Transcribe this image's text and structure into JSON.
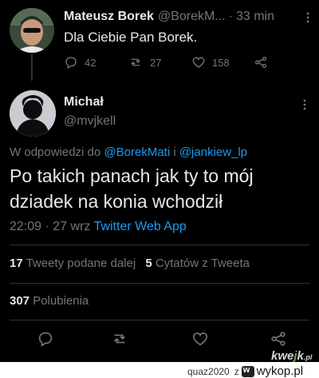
{
  "parent_tweet": {
    "author_name": "Mateusz Borek",
    "author_handle": "@BorekM...",
    "separator": "·",
    "time": "33 min",
    "text": "Dla Ciebie Pan Borek.",
    "replies": "42",
    "retweets": "27",
    "likes": "158"
  },
  "main_tweet": {
    "author_name": "Michał",
    "author_handle": "@mvjkell",
    "reply_prefix": "W odpowiedzi do ",
    "reply_user_1": "@BorekMati",
    "reply_conj": " i ",
    "reply_user_2": "@jankiew_lp",
    "text_line1": "Po takich panach jak ty to mój",
    "text_line2": "dziadek na konia wchodził",
    "time": "22:09",
    "date": " · 27 wrz ",
    "source": "Twitter Web App"
  },
  "stats": {
    "retweets_count": "17",
    "retweets_label": " Tweety podane dalej",
    "quotes_count": "5",
    "quotes_label": " Cytatów z Tweeta",
    "likes_count": "307",
    "likes_label": " Polubienia"
  },
  "watermark": {
    "kw": "kw",
    "e": "e",
    "j": "j",
    "k": "k",
    "pl": ".pl"
  },
  "footer": {
    "user": "quaz2020",
    "z": "z",
    "logo_letter": "w",
    "site": "wykop.pl"
  },
  "colors": {
    "background": "#000000",
    "text": "#e7e9ea",
    "secondary": "#71767b",
    "link": "#1d9bf0",
    "divider": "#2f3336"
  }
}
